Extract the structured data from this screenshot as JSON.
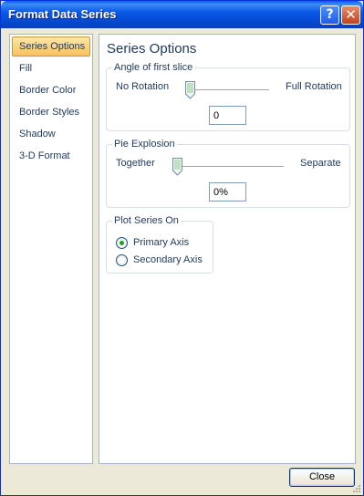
{
  "window": {
    "title": "Format Data Series",
    "help_glyph": "?",
    "close_glyph": "✕"
  },
  "sidebar": {
    "items": [
      {
        "label": "Series Options",
        "selected": true
      },
      {
        "label": "Fill",
        "selected": false
      },
      {
        "label": "Border Color",
        "selected": false
      },
      {
        "label": "Border Styles",
        "selected": false
      },
      {
        "label": "Shadow",
        "selected": false
      },
      {
        "label": "3-D Format",
        "selected": false
      }
    ]
  },
  "main": {
    "heading": "Series Options",
    "angle_group": {
      "legend": "Angle of first slice",
      "min_label": "No Rotation",
      "max_label": "Full Rotation",
      "slider_value_fraction": 0.0,
      "value": "0"
    },
    "explosion_group": {
      "legend": "Pie Explosion",
      "min_label": "Together",
      "max_label": "Separate",
      "slider_value_fraction": 0.0,
      "value": "0%"
    },
    "plot_on_group": {
      "legend": "Plot Series On",
      "options": [
        {
          "label": "Primary Axis",
          "checked": true
        },
        {
          "label": "Secondary Axis",
          "checked": false
        }
      ]
    }
  },
  "footer": {
    "close_label": "Close"
  },
  "colors": {
    "title_bar": "#0a58ef",
    "selected_item": "#f8c159",
    "radio_dot": "#21a121"
  }
}
